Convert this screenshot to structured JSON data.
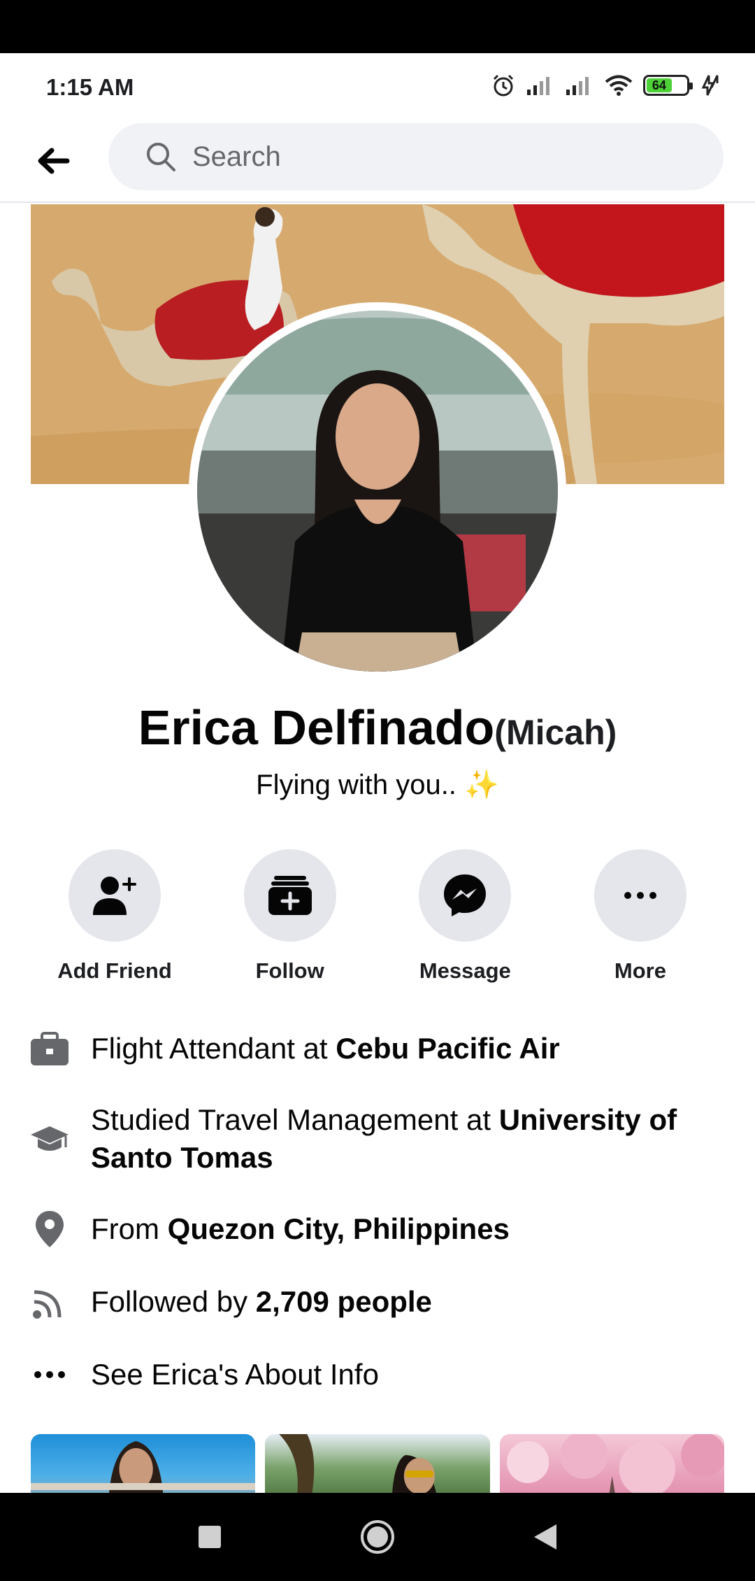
{
  "status_bar": {
    "time": "1:15 AM",
    "battery_level": "64",
    "icons": [
      "alarm-icon",
      "signal-icon",
      "signal-icon",
      "wifi-icon",
      "battery-icon",
      "charging-icon"
    ]
  },
  "header": {
    "back_icon": "arrow-left-icon",
    "search_placeholder": "Search"
  },
  "profile": {
    "name": "Erica Delfinado",
    "alternate_name": "(Micah)",
    "bio": "Flying with you..",
    "bio_emoji": "✨"
  },
  "actions": [
    {
      "label": "Add Friend",
      "icon": "add-friend-icon"
    },
    {
      "label": "Follow",
      "icon": "follow-icon"
    },
    {
      "label": "Message",
      "icon": "messenger-icon"
    },
    {
      "label": "More",
      "icon": "more-icon"
    }
  ],
  "info": {
    "work": {
      "prefix": "Flight Attendant at ",
      "bold": "Cebu Pacific Air",
      "icon": "briefcase-icon"
    },
    "education": {
      "prefix": "Studied Travel Management at ",
      "bold": "University of Santo Tomas",
      "icon": "graduation-cap-icon"
    },
    "location": {
      "prefix": "From ",
      "bold": "Quezon City, Philippines",
      "icon": "location-pin-icon"
    },
    "followers": {
      "prefix": "Followed by ",
      "bold": "2,709 people",
      "icon": "rss-feed-icon"
    },
    "about": {
      "text": "See Erica's About Info",
      "icon": "more-dots-icon"
    }
  },
  "colors": {
    "accent_gray": "#e4e6eb",
    "icon_gray": "#65676b",
    "text_dark": "#050505",
    "battery_green": "#4cd137"
  }
}
